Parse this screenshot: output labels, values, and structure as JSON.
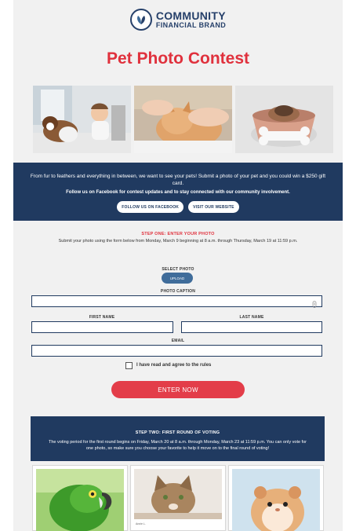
{
  "brand": {
    "line1": "COMMUNITY",
    "line2": "FINANCIAL BRAND"
  },
  "title": "Pet Photo Contest",
  "photos": [
    {
      "icon": "dog-and-baby-photo"
    },
    {
      "icon": "cat-being-petted-photo"
    },
    {
      "icon": "puppy-in-bowl-photo"
    }
  ],
  "intro": {
    "text": "From fur to feathers and everything in between, we want to see your pets! Submit a photo of your pet and you could win a $250 gift card.",
    "follow": "Follow us on Facebook for contest updates and to stay connected with our community involvement.",
    "facebook_button": "FOLLOW US ON FACEBOOK",
    "website_button": "VISIT OUR WEBSITE"
  },
  "step_one": {
    "title": "STEP ONE: ENTER YOUR PHOTO",
    "description": "Submit your photo using the form below from Monday, March 9 beginning at 8 a.m. through Thursday, March 19 at 11:59 p.m."
  },
  "form": {
    "select_photo_label": "SELECT PHOTO",
    "upload_button": "UPLOAD",
    "caption_label": "PHOTO CAPTION",
    "first_name_label": "FIRST NAME",
    "last_name_label": "LAST NAME",
    "email_label": "EMAIL",
    "agree_label": "I have read and agree to the rules",
    "submit_button": "ENTER NOW"
  },
  "step_two": {
    "title": "STEP TWO: FIRST ROUND OF VOTING",
    "description": "The voting period for the first round begins on Friday, March 20 at 8 a.m. through Monday, March 23 at 11:59 p.m. You can only vote for one photo, so make sure you choose your favorite to help it move on to the final round of voting!"
  },
  "entries": [
    {
      "icon": "parrot-photo",
      "caption": ""
    },
    {
      "icon": "tabby-cat-photo",
      "caption": "Annie L."
    },
    {
      "icon": "hamster-photo",
      "caption": ""
    }
  ],
  "colors": {
    "accent_red": "#e0313d",
    "navy": "#203a60",
    "upload_blue": "#3f6c9a"
  }
}
